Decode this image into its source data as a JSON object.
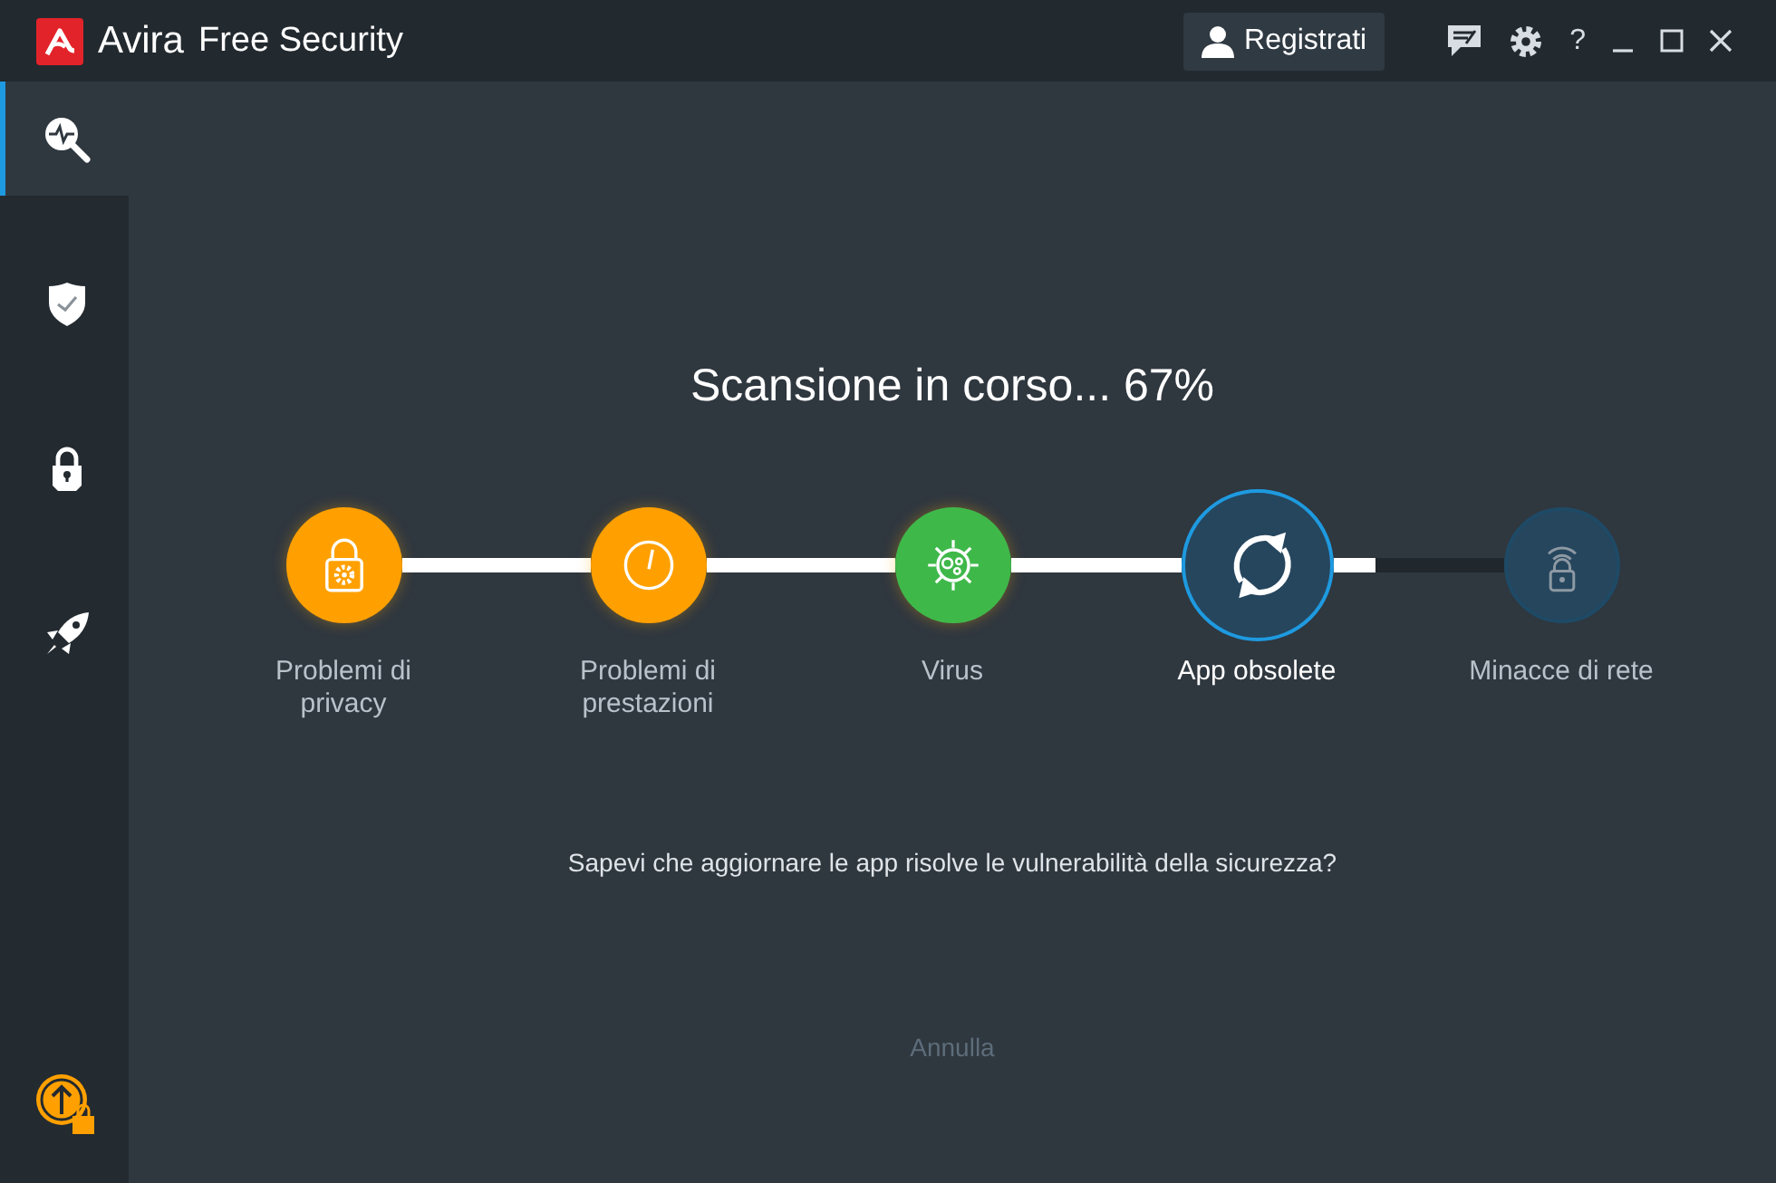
{
  "window": {
    "app_name": "Avira",
    "title": "Free Security"
  },
  "header": {
    "register_button": "Registrati",
    "help": "?"
  },
  "sidebar": {
    "items": [
      {
        "kind": "scan",
        "selected": true
      },
      {
        "kind": "shield",
        "selected": false
      },
      {
        "kind": "lock",
        "selected": false
      },
      {
        "kind": "rocket",
        "selected": false
      }
    ]
  },
  "scan": {
    "heading": "Scansione in corso... 67%",
    "steps": [
      {
        "label": "Problemi di privacy",
        "kind": "privacy",
        "done": true,
        "active": false,
        "color": "#ffa000",
        "connector": {
          "level": 1
        }
      },
      {
        "label": "Problemi di prestazioni",
        "kind": "performance",
        "done": true,
        "active": false,
        "color": "#ffa000",
        "connector": {
          "level": 1
        }
      },
      {
        "label": "Virus",
        "kind": "virus",
        "done": true,
        "active": false,
        "color": "#3fb84a",
        "connector": {
          "level": 1
        }
      },
      {
        "label": "App obsolete",
        "kind": "update",
        "done": false,
        "active": true,
        "connector": {
          "level": 0.25
        }
      },
      {
        "label": "Minacce di rete",
        "kind": "network",
        "done": false,
        "active": false
      }
    ],
    "tip": "Sapevi che aggiornare le app risolve le vulnerabilità della sicurezza?",
    "cancel": {
      "label": "Annulla",
      "disabled": true
    }
  }
}
